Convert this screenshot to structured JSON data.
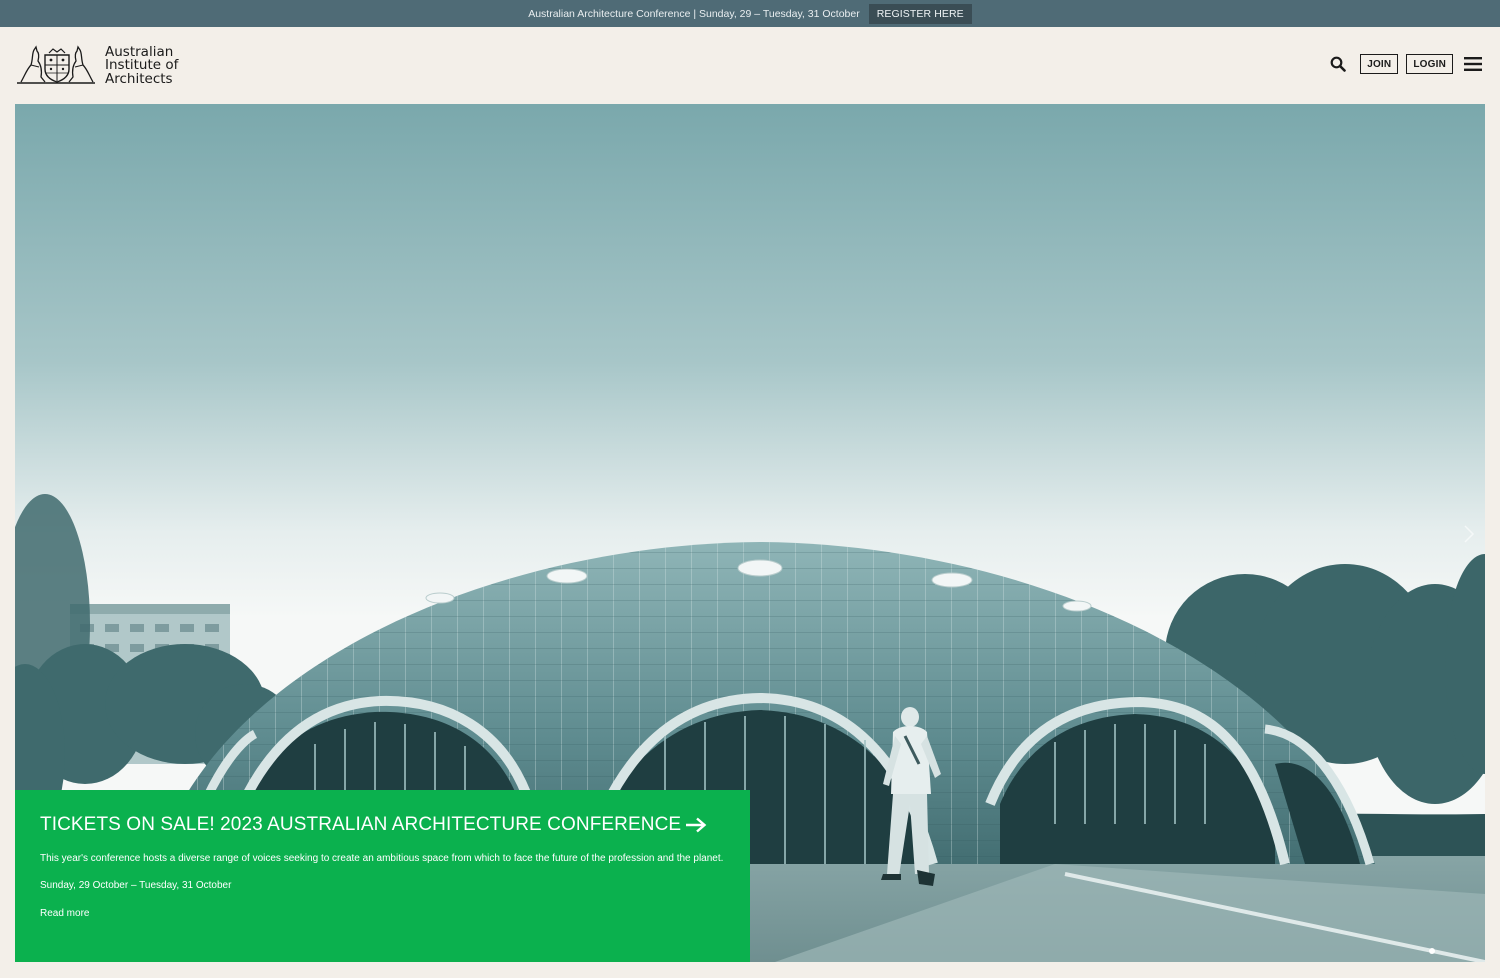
{
  "topbar": {
    "announcement": "Australian Architecture Conference | Sunday, 29 – Tuesday, 31 October",
    "register_label": "REGISTER HERE"
  },
  "header": {
    "logo_lines": [
      "Australian",
      "Institute of",
      "Architects"
    ],
    "search_icon": "search-icon",
    "join_label": "JOIN",
    "login_label": "LOGIN",
    "menu_icon": "hamburger-menu-icon"
  },
  "hero": {
    "slides_count": 1,
    "active_slide": 1,
    "card": {
      "title": "TICKETS ON SALE! 2023 AUSTRALIAN ARCHITECTURE CONFERENCE",
      "description": "This year's conference hosts a diverse range of voices seeking to create an ambitious space from which to face the future of the profession and the planet.",
      "date": "Sunday, 29 October – Tuesday, 31 October",
      "read_more": "Read more"
    },
    "colors": {
      "card_bg": "#0bb14e",
      "sky_top": "#7eaaae",
      "topbar_bg": "#4f6b76"
    }
  }
}
